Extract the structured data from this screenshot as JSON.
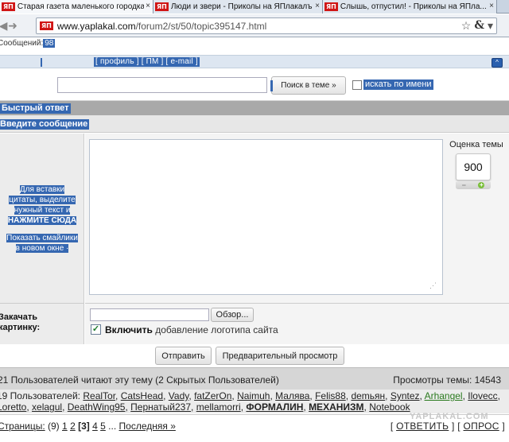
{
  "browser": {
    "tabs": [
      {
        "favicon": "ЯП",
        "label": "Старая газета маленького городка - ...",
        "close": "×"
      },
      {
        "favicon": "ЯП",
        "label": "Люди и звери - Приколы на ЯПлакалъ",
        "close": "×"
      },
      {
        "favicon": "ЯП",
        "label": "Слышь, отпустил! - Приколы на ЯПла...",
        "close": "×"
      }
    ],
    "url_favicon": "ЯП",
    "url_host": "www.yaplakal.com",
    "url_path": "/forum2/st/50/topic395147.html"
  },
  "topbar": {
    "messages_label": "Сообщений:",
    "messages_count": "98",
    "profile_links": "[ профиль ] [ ПМ ] [ e-mail ]",
    "up_arrow": "^"
  },
  "search": {
    "input_value": "",
    "button_label": "Поиск в теме »",
    "name_checkbox_label": "искать по имени"
  },
  "quick_reply": {
    "title": "Быстрый ответ",
    "enter_message": "Введите сообщение",
    "quote_help_line1": "Для вставки",
    "quote_help_line2": "цитаты, выделите",
    "quote_help_line3": "нужный текст и",
    "quote_help_line4": "НАЖМИТЕ СЮДА",
    "smileys_line1": "Показать смайлики",
    "smileys_line2": "в новом окне ·",
    "rating_label": "Оценка темы",
    "rating_value": "900",
    "rating_minus": "−",
    "rating_plus": "+"
  },
  "upload": {
    "label_line1": "Закачать",
    "label_line2": "картинку:",
    "browse_label": "Обзор...",
    "logo_check": "✓",
    "logo_enable": "Включить",
    "logo_text": "добавление логотипа сайта"
  },
  "actions": {
    "send_label": "Отправить",
    "preview_label": "Предварительный просмотр"
  },
  "stats": {
    "readers": "21 Пользователей читают эту тему (2 Скрытых Пользователей)",
    "views": "Просмотры темы: 14543",
    "users_prefix": "19 Пользователей:",
    "users": [
      {
        "name": "RealTor",
        "style": "link"
      },
      {
        "name": "CatsHead",
        "style": "link"
      },
      {
        "name": "Vady",
        "style": "link"
      },
      {
        "name": "fatZerOn",
        "style": "link"
      },
      {
        "name": "Naimuh",
        "style": "link"
      },
      {
        "name": "Малява",
        "style": "link"
      },
      {
        "name": "Felis88",
        "style": "link"
      },
      {
        "name": "demьян",
        "style": "link"
      },
      {
        "name": "Syntez",
        "style": "link"
      },
      {
        "name": "Arhangel",
        "style": "green"
      },
      {
        "name": "Ilovecc",
        "style": "link"
      },
      {
        "name": "Loretto",
        "style": "link"
      },
      {
        "name": "xelagul",
        "style": "link"
      },
      {
        "name": "DeathWing95",
        "style": "link"
      },
      {
        "name": "Пернатый237",
        "style": "link"
      },
      {
        "name": "mellamorri",
        "style": "link"
      },
      {
        "name": "ФОРМАЛИН",
        "style": "bold"
      },
      {
        "name": "МЕХАНИЗМ",
        "style": "bold"
      },
      {
        "name": "Notebook",
        "style": "link"
      }
    ]
  },
  "pager": {
    "label": "Страницы:",
    "total": "(9)",
    "pages": [
      "1",
      "2",
      "[3]",
      "4",
      "5"
    ],
    "current": "[3]",
    "ellipsis": "...",
    "last": "Последняя »",
    "reply_open": "[",
    "reply_label": "ОТВЕТИТЬ",
    "reply_mid": "] [",
    "poll_label": "ОПРОС",
    "reply_close": "]",
    "watermark": "YAPLAKAL.COM"
  }
}
